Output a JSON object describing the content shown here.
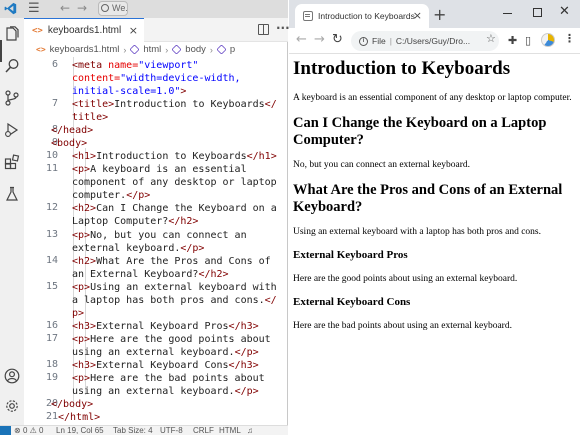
{
  "vscode": {
    "title_search": "We...",
    "tab": {
      "icon": "<>",
      "label": "keyboards1.html",
      "close": "×"
    },
    "breadcrumb": {
      "file_icon": "<>",
      "file": "keyboards1.html",
      "sep": "›",
      "items": [
        "html",
        "body",
        "p"
      ]
    },
    "code_lines": [
      {
        "n": "6",
        "row": 0,
        "indent": 2,
        "segs": [
          [
            "t",
            "<meta "
          ],
          [
            "a",
            "name="
          ],
          [
            "s",
            "\"viewport\""
          ]
        ]
      },
      {
        "n": "",
        "row": 1,
        "indent": 2,
        "segs": [
          [
            "a",
            "content="
          ],
          [
            "s",
            "\"width=device-width,"
          ]
        ]
      },
      {
        "n": "",
        "row": 2,
        "indent": 2,
        "segs": [
          [
            "s",
            "initial-scale=1.0\""
          ],
          [
            "t",
            ">"
          ]
        ]
      },
      {
        "n": "7",
        "row": 3,
        "indent": 2,
        "segs": [
          [
            "t",
            "<title>"
          ],
          [
            "x",
            "Introduction to Keyboards"
          ],
          [
            "t",
            "</"
          ]
        ]
      },
      {
        "n": "",
        "row": 4,
        "indent": 2,
        "segs": [
          [
            "t",
            "title>"
          ]
        ]
      },
      {
        "n": "8",
        "row": 5,
        "indent": 1,
        "segs": [
          [
            "t",
            "</head>"
          ]
        ]
      },
      {
        "n": "9",
        "row": 6,
        "indent": 1,
        "segs": [
          [
            "t",
            "<body>"
          ]
        ]
      },
      {
        "n": "10",
        "row": 7,
        "indent": 2,
        "segs": [
          [
            "t",
            "<h1>"
          ],
          [
            "x",
            "Introduction to Keyboards"
          ],
          [
            "t",
            "</h1>"
          ]
        ]
      },
      {
        "n": "11",
        "row": 8,
        "indent": 2,
        "segs": [
          [
            "t",
            "<p>"
          ],
          [
            "x",
            "A keyboard is an essential"
          ]
        ]
      },
      {
        "n": "",
        "row": 9,
        "indent": 2,
        "segs": [
          [
            "x",
            "component of any desktop or laptop"
          ]
        ]
      },
      {
        "n": "",
        "row": 10,
        "indent": 2,
        "segs": [
          [
            "x",
            "computer."
          ],
          [
            "t",
            "</p>"
          ]
        ]
      },
      {
        "n": "12",
        "row": 11,
        "indent": 2,
        "segs": [
          [
            "t",
            "<h2>"
          ],
          [
            "x",
            "Can I Change the Keyboard on a"
          ]
        ]
      },
      {
        "n": "",
        "row": 12,
        "indent": 2,
        "segs": [
          [
            "x",
            "Laptop Computer?"
          ],
          [
            "t",
            "</h2>"
          ]
        ]
      },
      {
        "n": "13",
        "row": 13,
        "indent": 2,
        "segs": [
          [
            "t",
            "<p>"
          ],
          [
            "x",
            "No, but you can connect an"
          ]
        ]
      },
      {
        "n": "",
        "row": 14,
        "indent": 2,
        "segs": [
          [
            "x",
            "external keyboard."
          ],
          [
            "t",
            "</p>"
          ]
        ]
      },
      {
        "n": "14",
        "row": 15,
        "indent": 2,
        "segs": [
          [
            "t",
            "<h2>"
          ],
          [
            "x",
            "What Are the Pros and Cons of"
          ]
        ]
      },
      {
        "n": "",
        "row": 16,
        "indent": 2,
        "segs": [
          [
            "x",
            "an External Keyboard?"
          ],
          [
            "t",
            "</h2>"
          ]
        ]
      },
      {
        "n": "15",
        "row": 17,
        "indent": 2,
        "segs": [
          [
            "t",
            "<p>"
          ],
          [
            "x",
            "Using an external keyboard with"
          ]
        ]
      },
      {
        "n": "",
        "row": 18,
        "indent": 2,
        "segs": [
          [
            "x",
            "a laptop has both pros and cons."
          ],
          [
            "t",
            "</"
          ]
        ]
      },
      {
        "n": "",
        "row": 19,
        "indent": 2,
        "segs": [
          [
            "t",
            "p>"
          ]
        ]
      },
      {
        "n": "16",
        "row": 20,
        "indent": 2,
        "segs": [
          [
            "t",
            "<h3>"
          ],
          [
            "x",
            "External Keyboard Pros"
          ],
          [
            "t",
            "</h3>"
          ]
        ]
      },
      {
        "n": "17",
        "row": 21,
        "indent": 2,
        "segs": [
          [
            "t",
            "<p>"
          ],
          [
            "x",
            "Here are the good points about"
          ]
        ]
      },
      {
        "n": "",
        "row": 22,
        "indent": 2,
        "segs": [
          [
            "x",
            "using an external keyboard."
          ],
          [
            "t",
            "</p>"
          ]
        ]
      },
      {
        "n": "18",
        "row": 23,
        "indent": 2,
        "segs": [
          [
            "t",
            "<h3>"
          ],
          [
            "x",
            "External Keyboard Cons"
          ],
          [
            "t",
            "</h3>"
          ]
        ]
      },
      {
        "n": "19",
        "row": 24,
        "indent": 2,
        "segs": [
          [
            "t",
            "<p>"
          ],
          [
            "x",
            "Here are the bad points about"
          ]
        ]
      },
      {
        "n": "",
        "row": 25,
        "indent": 2,
        "segs": [
          [
            "x",
            "using an external keyboard."
          ],
          [
            "t",
            "</p>"
          ]
        ]
      },
      {
        "n": "20",
        "row": 26,
        "indent": 1,
        "segs": [
          [
            "t",
            "</body>"
          ]
        ]
      },
      {
        "n": "21",
        "row": 27,
        "indent": 0,
        "segs": [
          [
            "t",
            "</html>"
          ]
        ]
      }
    ],
    "status": {
      "errors": "0",
      "warnings": "0",
      "position": "Ln 19, Col 65",
      "tab_size": "Tab Size: 4",
      "encoding": "UTF-8",
      "eol": "CRLF",
      "language": "HTML"
    }
  },
  "chrome": {
    "tab_title": "Introduction to Keyboards",
    "tab_close": "×",
    "new_tab": "+",
    "address_prefix": "File",
    "address": "C:/Users/Guy/Dro...",
    "page": {
      "h1": "Introduction to Keyboards",
      "p1": "A keyboard is an essential component of any desktop or laptop computer.",
      "h2_1": "Can I Change the Keyboard on a Laptop Computer?",
      "p2": "No, but you can connect an external keyboard.",
      "h2_2": "What Are the Pros and Cons of an External Keyboard?",
      "p3": "Using an external keyboard with a laptop has both pros and cons.",
      "h3_1": "External Keyboard Pros",
      "p4": "Here are the good points about using an external keyboard.",
      "h3_2": "External Keyboard Cons",
      "p5": "Here are the bad points about using an external keyboard."
    }
  },
  "colors": {
    "tag": "#800000",
    "attr_name": "#e50000",
    "attr_value": "#0000ff",
    "accent": "#2a73d6"
  },
  "icons": {
    "activity_bar": [
      "explorer-icon",
      "search-icon",
      "source-control-icon",
      "run-debug-icon",
      "extensions-icon",
      "testing-icon",
      "accounts-icon",
      "manage-gear-icon"
    ]
  }
}
